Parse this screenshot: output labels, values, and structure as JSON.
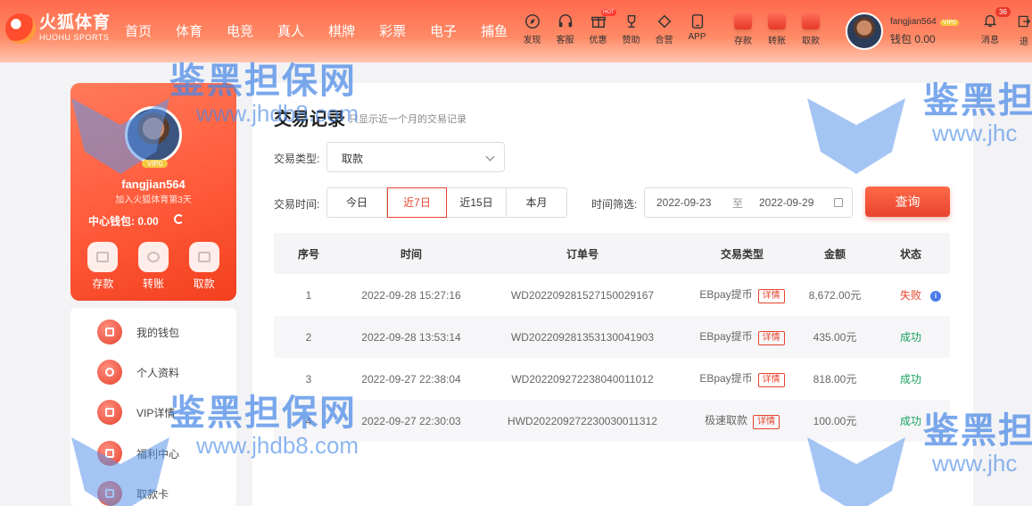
{
  "brand": {
    "name_cn": "火狐体育",
    "name_en": "HUOHU SPORTS"
  },
  "nav": [
    "首页",
    "体育",
    "电竞",
    "真人",
    "棋牌",
    "彩票",
    "电子",
    "捕鱼"
  ],
  "tools": [
    {
      "label": "发现",
      "icon": "compass-icon"
    },
    {
      "label": "客服",
      "icon": "headset-icon"
    },
    {
      "label": "优惠",
      "icon": "gift-icon",
      "hot": "HOT"
    },
    {
      "label": "赞助",
      "icon": "trophy-icon"
    },
    {
      "label": "合营",
      "icon": "diamond-icon"
    },
    {
      "label": "APP",
      "icon": "tablet-icon"
    }
  ],
  "money_tools": [
    "存款",
    "转账",
    "取款"
  ],
  "user": {
    "name": "fangjian564",
    "vip": "VIP0",
    "wallet": "钱包 0.00"
  },
  "messages": {
    "label": "消息",
    "count": "36"
  },
  "logout": "退",
  "profile": {
    "vip": "VIP0",
    "name": "fangjian564",
    "sub": "加入火狐体育第3天",
    "wallet": "中心钱包: 0.00",
    "actions": [
      "存款",
      "转账",
      "取款"
    ]
  },
  "menu": [
    "我的钱包",
    "个人资料",
    "VIP详情",
    "福利中心",
    "取款卡"
  ],
  "records": {
    "title": "交易记录",
    "subtitle": "只显示近一个月的交易记录",
    "type_label": "交易类型:",
    "type_value": "取款",
    "time_label": "交易时间:",
    "time_options": [
      "今日",
      "近7日",
      "近15日",
      "本月"
    ],
    "time_active": "近7日",
    "filter_label": "时间筛选:",
    "date_from": "2022-09-23",
    "date_to": "2022-09-29",
    "to_word": "至",
    "query": "查询",
    "columns": [
      "序号",
      "时间",
      "订单号",
      "交易类型",
      "金额",
      "状态"
    ],
    "detail_label": "详情",
    "rows": [
      {
        "no": "1",
        "time": "2022-09-28 15:27:16",
        "order": "WD20220928152715002916​7",
        "type": "EBpay提币",
        "amount": "8,672.00元",
        "status": "失败"
      },
      {
        "no": "2",
        "time": "2022-09-28 13:53:14",
        "order": "WD20220928135313004190​3",
        "type": "EBpay提币",
        "amount": "435.00元",
        "status": "成功"
      },
      {
        "no": "3",
        "time": "2022-09-27 22:38:04",
        "order": "WD20220927223804001101​2",
        "type": "EBpay提币",
        "amount": "818.00元",
        "status": "成功"
      },
      {
        "no": "4",
        "time": "2022-09-27 22:30:03",
        "order": "HWD20220927223003001131​2",
        "type": "极速取款",
        "amount": "100.00元",
        "status": "成功"
      }
    ]
  },
  "watermark": {
    "text": "鉴黑担保网",
    "url": "www.jhdb8.com",
    "url_short": "www.jhc",
    "text_short": "鉴黑担"
  }
}
